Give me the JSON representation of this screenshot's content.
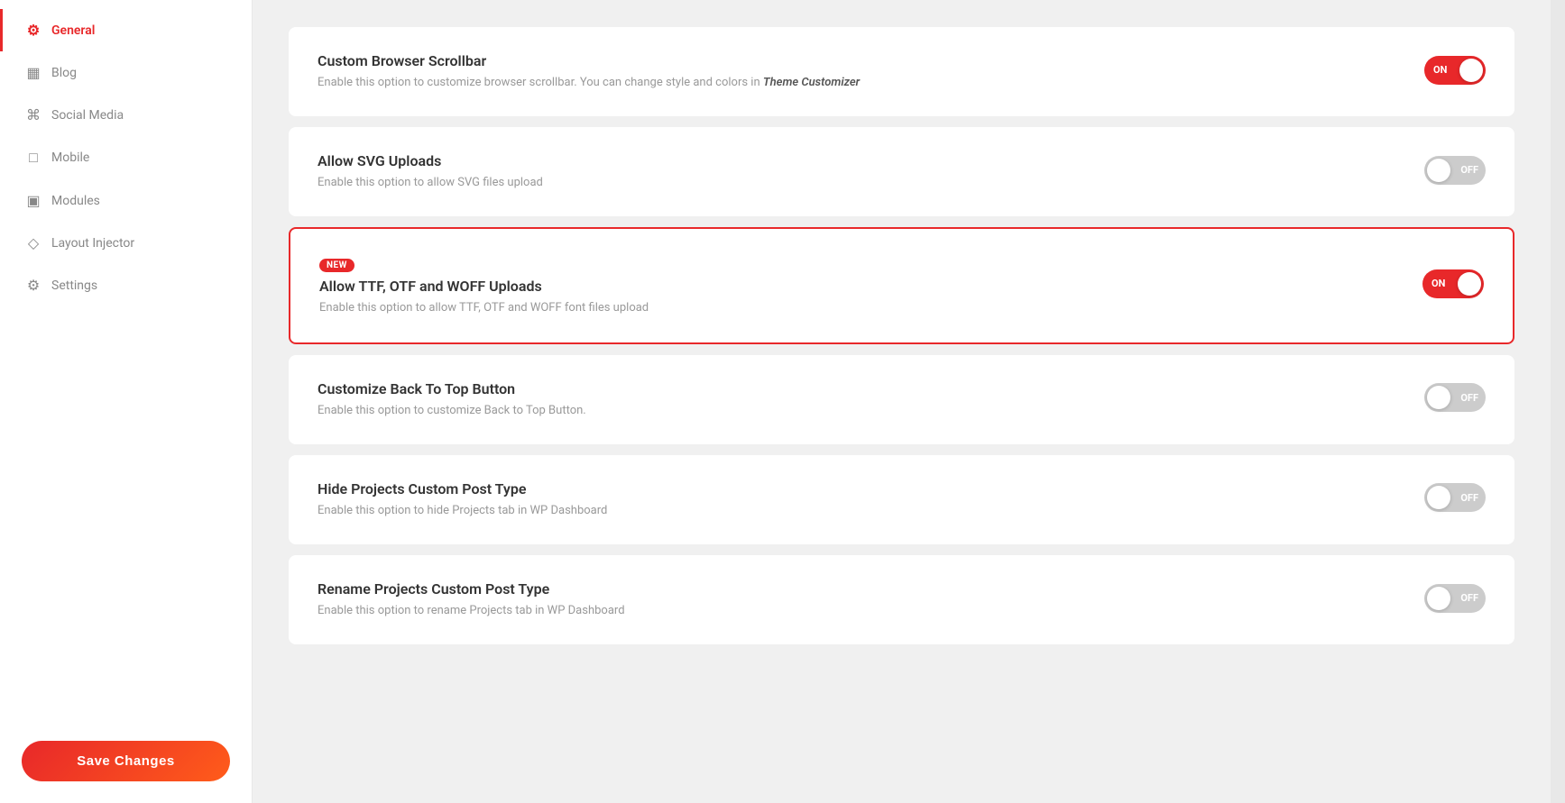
{
  "sidebar": {
    "items": [
      {
        "id": "general",
        "label": "General",
        "icon": "⚙",
        "active": true
      },
      {
        "id": "blog",
        "label": "Blog",
        "icon": "▦",
        "active": false
      },
      {
        "id": "social-media",
        "label": "Social Media",
        "icon": "⌘",
        "active": false
      },
      {
        "id": "mobile",
        "label": "Mobile",
        "icon": "□",
        "active": false
      },
      {
        "id": "modules",
        "label": "Modules",
        "icon": "▣",
        "active": false
      },
      {
        "id": "layout-injector",
        "label": "Layout Injector",
        "icon": "◇",
        "active": false
      },
      {
        "id": "settings",
        "label": "Settings",
        "icon": "⚙",
        "active": false
      }
    ],
    "save_button_label": "Save Changes"
  },
  "settings": [
    {
      "id": "custom-browser-scrollbar",
      "title": "Custom Browser Scrollbar",
      "desc_plain": "Enable this option to customize browser scrollbar. You can change style and colors in ",
      "desc_emphasis": "Theme Customizer",
      "has_badge": false,
      "toggle": "on"
    },
    {
      "id": "allow-svg-uploads",
      "title": "Allow SVG Uploads",
      "desc_plain": "Enable this option to allow SVG files upload",
      "desc_emphasis": "",
      "has_badge": false,
      "toggle": "off"
    },
    {
      "id": "allow-ttf-otf-woff",
      "title": "Allow TTF, OTF and WOFF Uploads",
      "desc_plain": "Enable this option to allow TTF, OTF and WOFF font files upload",
      "desc_emphasis": "",
      "has_badge": true,
      "badge_text": "NEW",
      "toggle": "on",
      "highlighted": true
    },
    {
      "id": "customize-back-to-top",
      "title": "Customize Back To Top Button",
      "desc_plain": "Enable this option to customize Back to Top Button.",
      "desc_emphasis": "",
      "has_badge": false,
      "toggle": "off"
    },
    {
      "id": "hide-projects-post-type",
      "title": "Hide Projects Custom Post Type",
      "desc_plain": "Enable this option to hide Projects tab in WP Dashboard",
      "desc_emphasis": "",
      "has_badge": false,
      "toggle": "off"
    },
    {
      "id": "rename-projects-post-type",
      "title": "Rename Projects Custom Post Type",
      "desc_plain": "Enable this option to rename Projects tab in WP Dashboard",
      "desc_emphasis": "",
      "has_badge": false,
      "toggle": "off"
    }
  ]
}
